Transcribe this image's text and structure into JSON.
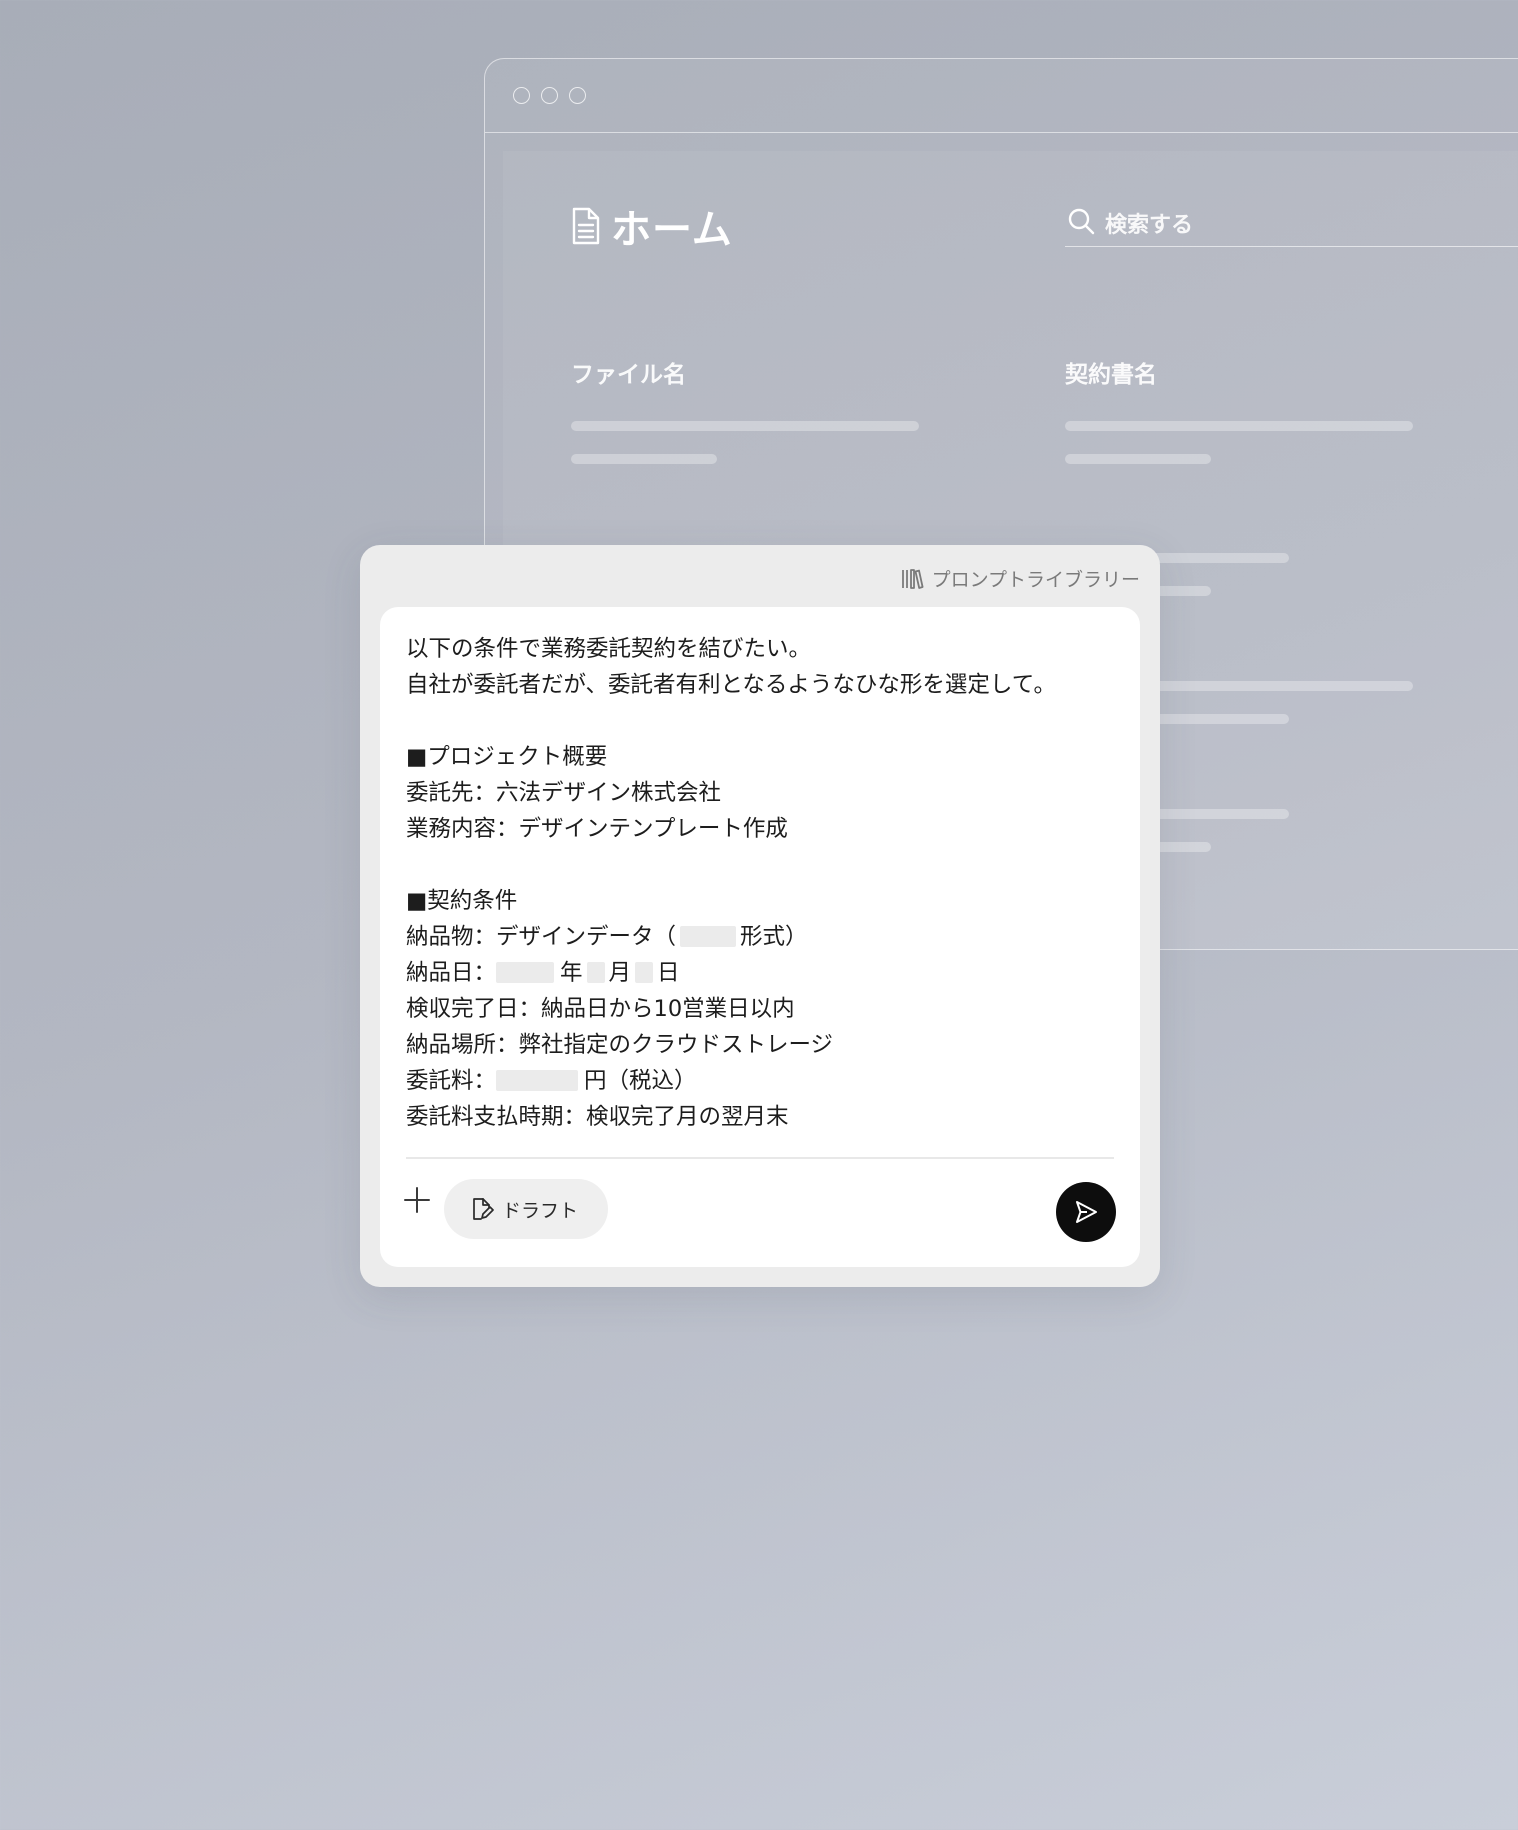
{
  "background_window": {
    "title": "ホーム",
    "search_placeholder": "検索する",
    "columns": [
      "ファイル名",
      "契約書名"
    ],
    "icons": {
      "title": "document-icon",
      "search": "search-icon"
    }
  },
  "panel": {
    "library_label": "プロンプトライブラリー",
    "prompt": {
      "intro1": "以下の条件で業務委託契約を結びたい。",
      "intro2": "自社が委託者だが、委託者有利となるようなひな形を選定して。",
      "section1": "■プロジェクト概要",
      "contractor": "委託先：六法デザイン株式会社",
      "work": "業務内容：デザインテンプレート作成",
      "section2": "■契約条件",
      "deliverable_prefix": "納品物：デザインデータ（",
      "deliverable_suffix": "形式）",
      "delivery_prefix": "納品日：",
      "year": "年",
      "month": "月",
      "day": "日",
      "inspection": "検収完了日：納品日から10営業日以内",
      "place": "納品場所：弊社指定のクラウドストレージ",
      "fee_prefix": "委託料：",
      "fee_suffix": "円（税込）",
      "payment": "委託料支払時期：検収完了月の翌月末"
    },
    "draft_label": "ドラフト",
    "icons": {
      "library": "books-icon",
      "add": "plus-icon",
      "draft": "document-edit-icon",
      "send": "send-icon"
    },
    "colors": {
      "send_button": "#0d0d0d",
      "panel": "#ececec",
      "card": "#ffffff"
    }
  }
}
